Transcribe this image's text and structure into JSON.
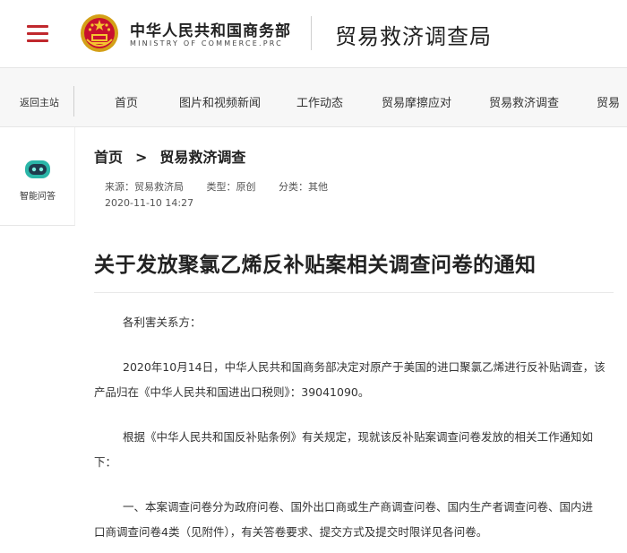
{
  "header": {
    "ministry_cn": "中华人民共和国商务部",
    "ministry_en": "MINISTRY OF COMMERCE.PRC",
    "bureau": "贸易救济调查局",
    "accent_color": "#c0282d"
  },
  "nav": {
    "back_home": "返回主站",
    "items": [
      "首页",
      "图片和视频新闻",
      "工作动态",
      "贸易摩擦应对",
      "贸易救济调查",
      "贸易"
    ]
  },
  "sidebar": {
    "assistant_label": "智能问答"
  },
  "breadcrumb": {
    "home": "首页",
    "separator": ">",
    "current": "贸易救济调查"
  },
  "meta": {
    "source": "来源：贸易救济局",
    "type": "类型：原创",
    "category": "分类：其他",
    "date": "2020-11-10 14:27"
  },
  "article": {
    "title": "关于发放聚氯乙烯反补贴案相关调查问卷的通知",
    "salutation": "各利害关系方：",
    "p1": [
      "2020年10月14日，中华人民共和国商务部决定对原产于美国的进口聚氯乙烯进行反补贴调查，该",
      "产品归在《中华人民共和国进出口税则》：39041090。"
    ],
    "p2": [
      "根据《中华人民共和国反补贴条例》有关规定，现就该反补贴案调查问卷发放的相关工作通知如",
      "下："
    ],
    "p3": [
      "一、本案调查问卷分为政府问卷、国外出口商或生产商调查问卷、国内生产者调查问卷、国内进",
      "口商调查问卷4类（见附件），有关答卷要求、提交方式及提交时限详见各问卷。"
    ]
  }
}
